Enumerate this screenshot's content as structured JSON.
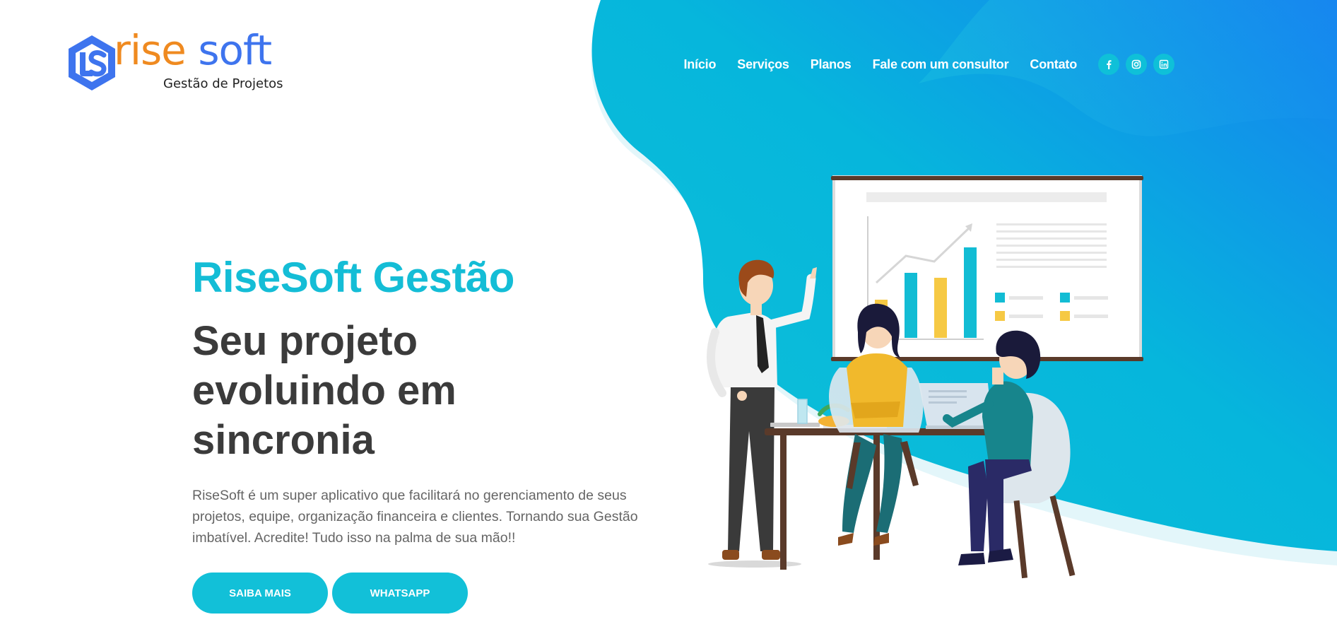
{
  "brand": {
    "name_part1": "rise",
    "name_part2": "soft",
    "tagline": "Gestão de Projetos"
  },
  "nav": {
    "items": [
      {
        "label": "Início"
      },
      {
        "label": "Serviços"
      },
      {
        "label": "Planos"
      },
      {
        "label": "Fale com um consultor"
      },
      {
        "label": "Contato"
      }
    ]
  },
  "social": {
    "icons": [
      "facebook-icon",
      "instagram-icon",
      "linkedin-icon"
    ],
    "color": "#0fc0d8"
  },
  "hero": {
    "title": "RiseSoft Gestão",
    "subtitle": "Seu projeto evoluindo em sincronia",
    "description": "RiseSoft é um super aplicativo que facilitará no gerenciamento de seus projetos, equipe, organização financeira e clientes. Tornando sua Gestão imbatível. Acredite! Tudo isso na palma de sua mão!!",
    "buttons": [
      {
        "label": "SAIBA MAIS"
      },
      {
        "label": "WHATSAPP"
      }
    ]
  },
  "colors": {
    "accent": "#12c0d8",
    "brand_orange": "#ef8a20",
    "brand_blue": "#3e74ee",
    "gradient_end": "#1680f0",
    "heading_dark": "#3b3b3b"
  }
}
